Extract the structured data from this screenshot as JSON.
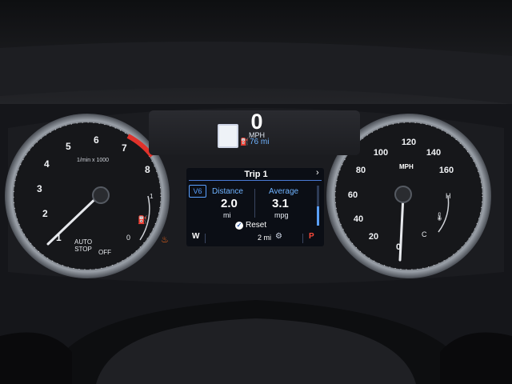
{
  "hud": {
    "speed": "0",
    "speed_unit": "MPH",
    "range": "76 mi",
    "fuel_icon": "fuel-range-icon"
  },
  "tach": {
    "ticks": [
      "1",
      "2",
      "3",
      "4",
      "5",
      "6",
      "7",
      "8"
    ],
    "note": "1/min x 1000",
    "fuel_full": "1",
    "fuel_empty": "0",
    "auto_stop": "AUTO\nSTOP",
    "off": "OFF",
    "needle_value_rpm_x1000": 0.3,
    "redline_start": 7
  },
  "speedo": {
    "ticks": [
      "0",
      "20",
      "40",
      "60",
      "80",
      "100",
      "120",
      "140",
      "160"
    ],
    "unit": "MPH",
    "temp_hot": "H",
    "temp_cold": "C",
    "needle_value_mph": 0
  },
  "trip": {
    "title": "Trip 1",
    "chevron": "›",
    "engine_badge": "V6",
    "distance_label": "Distance",
    "distance_value": "2.0",
    "distance_unit": "mi",
    "average_label": "Average",
    "average_value": "3.1",
    "average_unit": "mpg",
    "reset_label": "Reset"
  },
  "status": {
    "gear_left": "W",
    "odometer": "2 mi",
    "gear_right": "P"
  },
  "colors": {
    "accent": "#5aa0ff",
    "redline": "#e0322b",
    "warning": "#ff6a1a",
    "gear_park": "#ff4a3a"
  }
}
